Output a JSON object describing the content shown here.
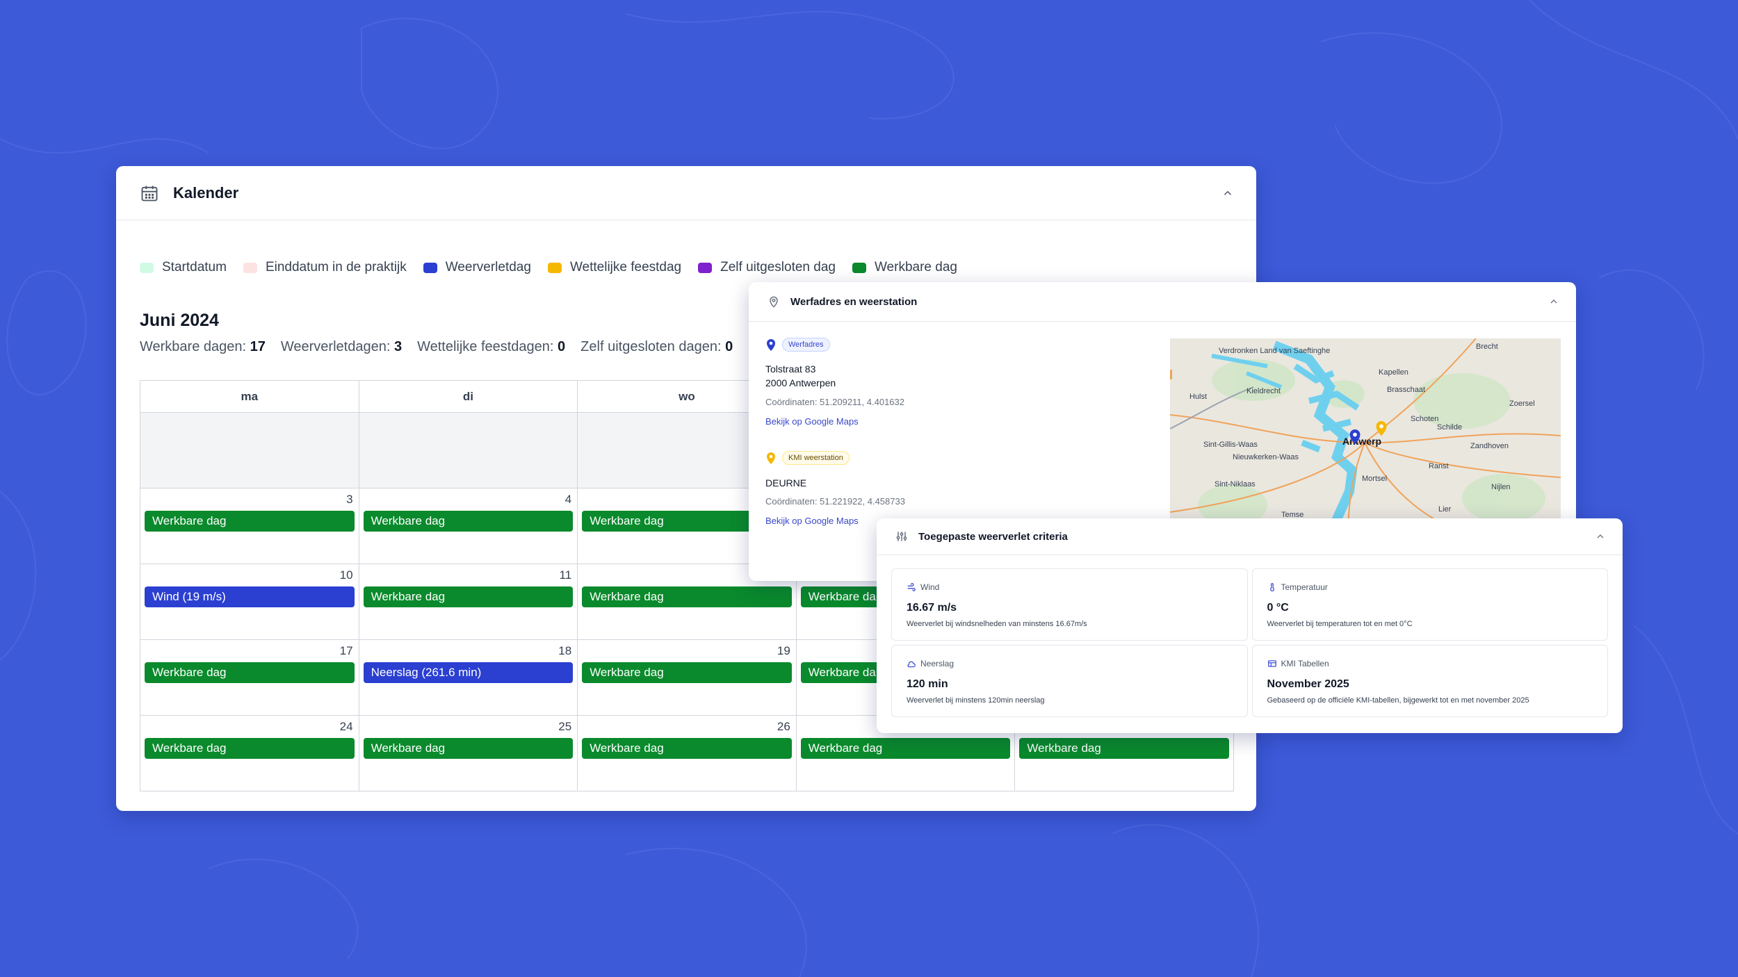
{
  "calendar": {
    "title": "Kalender",
    "legend": [
      {
        "label": "Startdatum",
        "color": "#d1fae5"
      },
      {
        "label": "Einddatum in de praktijk",
        "color": "#fde2e2"
      },
      {
        "label": "Weerverletdag",
        "color": "#2b3fd1"
      },
      {
        "label": "Wettelijke feestdag",
        "color": "#f5b800"
      },
      {
        "label": "Zelf uitgesloten dag",
        "color": "#7e22ce"
      },
      {
        "label": "Werkbare dag",
        "color": "#0a8a2c"
      }
    ],
    "month": "Juni 2024",
    "stats": [
      {
        "label": "Werkbare dagen:",
        "value": "17"
      },
      {
        "label": "Weerverletdagen:",
        "value": "3"
      },
      {
        "label": "Wettelijke feestdagen:",
        "value": "0"
      },
      {
        "label": "Zelf uitgesloten dagen:",
        "value": "0"
      }
    ],
    "weekdays": [
      "ma",
      "di",
      "wo",
      "",
      ""
    ],
    "weeks": [
      [
        {
          "day": "",
          "event": "",
          "type": "empty"
        },
        {
          "day": "",
          "event": "",
          "type": "empty"
        },
        {
          "day": "",
          "event": "",
          "type": "empty"
        },
        {
          "day": "",
          "event": "",
          "type": "empty"
        },
        {
          "day": "",
          "event": "",
          "type": "empty"
        }
      ],
      [
        {
          "day": "3",
          "event": "Werkbare dag",
          "type": "work"
        },
        {
          "day": "4",
          "event": "Werkbare dag",
          "type": "work"
        },
        {
          "day": "",
          "event": "Werkbare dag",
          "type": "work"
        },
        {
          "day": "",
          "event": "",
          "type": "none"
        },
        {
          "day": "",
          "event": "",
          "type": "none"
        }
      ],
      [
        {
          "day": "10",
          "event": "Wind (19 m/s)",
          "type": "weather"
        },
        {
          "day": "11",
          "event": "Werkbare dag",
          "type": "work"
        },
        {
          "day": "",
          "event": "Werkbare dag",
          "type": "work"
        },
        {
          "day": "",
          "event": "Werkbare da",
          "type": "work"
        },
        {
          "day": "",
          "event": "",
          "type": "none"
        }
      ],
      [
        {
          "day": "17",
          "event": "Werkbare dag",
          "type": "work"
        },
        {
          "day": "18",
          "event": "Neerslag (261.6 min)",
          "type": "weather"
        },
        {
          "day": "19",
          "event": "Werkbare dag",
          "type": "work"
        },
        {
          "day": "",
          "event": "Werkbare da",
          "type": "work"
        },
        {
          "day": "",
          "event": "",
          "type": "none"
        }
      ],
      [
        {
          "day": "24",
          "event": "Werkbare dag",
          "type": "work"
        },
        {
          "day": "25",
          "event": "Werkbare dag",
          "type": "work"
        },
        {
          "day": "26",
          "event": "Werkbare dag",
          "type": "work"
        },
        {
          "day": "",
          "event": "Werkbare dag",
          "type": "work"
        },
        {
          "day": "",
          "event": "Werkbare dag",
          "type": "work"
        }
      ]
    ]
  },
  "site": {
    "title": "Werfadres en weerstation",
    "werf": {
      "badge": "Werfadres",
      "street": "Tolstraat 83",
      "city": "2000 Antwerpen",
      "coords": "Coördinaten: 51.209211, 4.401632",
      "link": "Bekijk op Google Maps"
    },
    "station": {
      "badge": "KMI weerstation",
      "name": "DEURNE",
      "coords": "Coördinaten: 51.221922, 4.458733",
      "link": "Bekijk op Google Maps"
    },
    "map_labels": [
      {
        "text": "Verdronken Land van Saeftinghe"
      },
      {
        "text": "Brecht"
      },
      {
        "text": "Kapellen"
      },
      {
        "text": "Hulst"
      },
      {
        "text": "Kieldrecht"
      },
      {
        "text": "Brasschaat"
      },
      {
        "text": "Zoersel"
      },
      {
        "text": "Schoten"
      },
      {
        "text": "Schilde"
      },
      {
        "text": "Sint-Gillis-Waas"
      },
      {
        "text": "Antwerp"
      },
      {
        "text": "Zandhoven"
      },
      {
        "text": "Nieuwkerken-Waas"
      },
      {
        "text": "Ranst"
      },
      {
        "text": "Mortsel"
      },
      {
        "text": "Sint-Niklaas"
      },
      {
        "text": "Nijlen"
      },
      {
        "text": "Temse"
      },
      {
        "text": "Lier"
      }
    ]
  },
  "criteria": {
    "title": "Toegepaste weerverlet criteria",
    "items": [
      {
        "label": "Wind",
        "value": "16.67 m/s",
        "desc": "Weerverlet bij windsnelheden van minstens 16.67m/s",
        "icon": "wind-icon"
      },
      {
        "label": "Temperatuur",
        "value": "0 °C",
        "desc": "Weerverlet bij temperaturen tot en met 0°C",
        "icon": "thermometer-icon"
      },
      {
        "label": "Neerslag",
        "value": "120 min",
        "desc": "Weerverlet bij minstens 120min neerslag",
        "icon": "rain-icon"
      },
      {
        "label": "KMI Tabellen",
        "value": "November 2025",
        "desc": "Gebaseerd op de officiële KMI-tabellen, bijgewerkt tot en met november 2025",
        "icon": "table-icon"
      }
    ]
  }
}
